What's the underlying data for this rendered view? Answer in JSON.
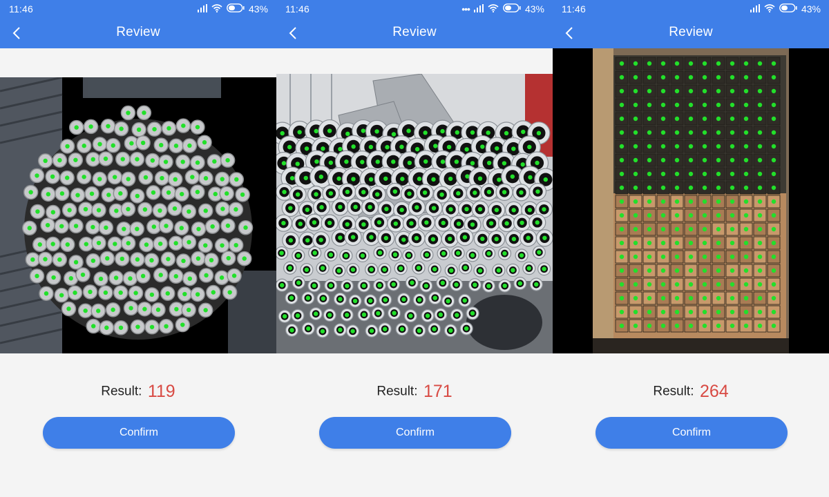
{
  "screens": [
    {
      "status": {
        "time": "11:46",
        "battery": "43%"
      },
      "header": {
        "title": "Review"
      },
      "photo": {
        "subject": "rebar-bundle"
      },
      "result": {
        "label": "Result:",
        "value": "119"
      },
      "confirm_label": "Confirm"
    },
    {
      "status": {
        "time": "11:46",
        "battery": "43%"
      },
      "header": {
        "title": "Review"
      },
      "photo": {
        "subject": "steel-pipes"
      },
      "result": {
        "label": "Result:",
        "value": "171"
      },
      "confirm_label": "Confirm"
    },
    {
      "status": {
        "time": "11:46",
        "battery": "43%"
      },
      "header": {
        "title": "Review"
      },
      "photo": {
        "subject": "timber-stack"
      },
      "result": {
        "label": "Result:",
        "value": "264"
      },
      "confirm_label": "Confirm"
    }
  ],
  "colors": {
    "accent": "#3f7fe8",
    "result_value": "#d84a43",
    "marker": "#22e02a",
    "marker_alt": "#ff1a1a",
    "background": "#f4f4f4"
  }
}
